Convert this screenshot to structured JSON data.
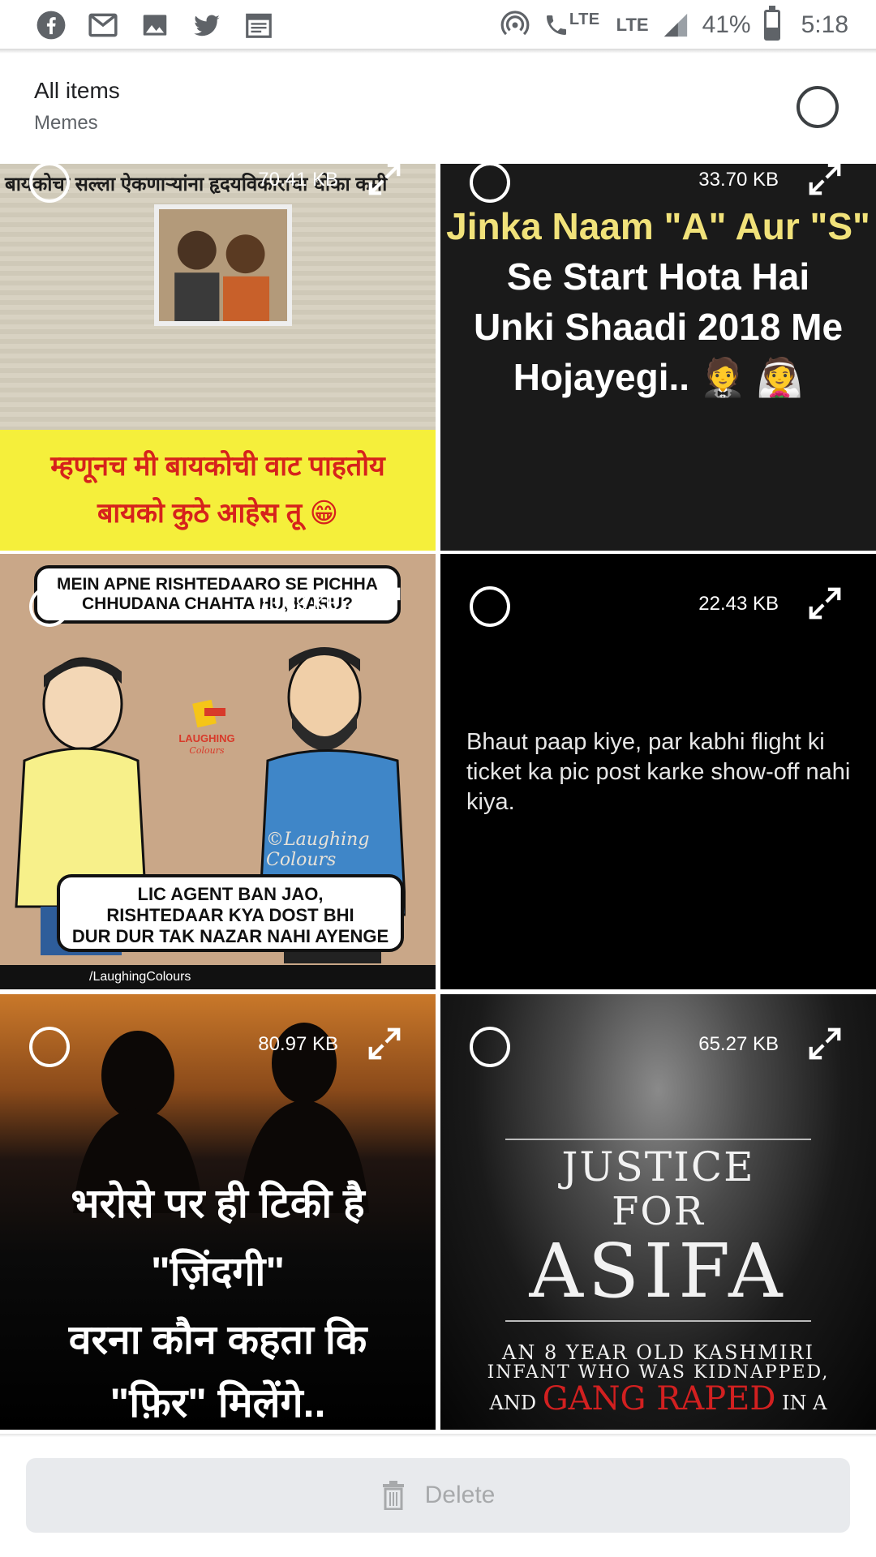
{
  "status_bar": {
    "icons_left": [
      "facebook-icon",
      "gmail-icon",
      "photos-icon",
      "twitter-icon",
      "calendar-icon"
    ],
    "lte_call_label": "LTE",
    "network_label": "LTE",
    "battery_percent": "41%",
    "battery_level": 0.41,
    "time": "5:18"
  },
  "header": {
    "title": "All items",
    "subtitle": "Memes"
  },
  "items": [
    {
      "size": "70.41 KB",
      "headline": "बायकोचा सल्ला ऐकणाऱ्यांना हृदयविकाराचा धोका कमी",
      "caption_line1": "म्हणूनच मी बायकोची वाट पाहतोय",
      "caption_line2": "बायको कुठे आहेस तू 😁"
    },
    {
      "size": "33.70 KB",
      "line1": "Jinka Naam \"A\" Aur \"S\"",
      "line2": "Se Start Hota Hai",
      "line3": "Unki Shaadi 2018 Me",
      "line4": "Hojayegi.. 🤵 👰"
    },
    {
      "size": "73.89 KB",
      "bubble_top_line1": "MEIN APNE RISHTEDAARO SE PICHHA",
      "bubble_top_line2": "CHHUDANA CHAHTA HU, KARU?",
      "bubble_bottom_line1": "LIC AGENT BAN JAO,",
      "bubble_bottom_line2": "RISHTEDAAR KYA DOST BHI",
      "bubble_bottom_line3": "DUR DUR TAK NAZAR NAHI AYENGE",
      "watermark": "©Laughing Colours",
      "footer": "/LaughingColours"
    },
    {
      "size": "22.43 KB",
      "text": "Bhaut paap kiye, par kabhi flight ki ticket ka pic post karke show-off nahi kiya."
    },
    {
      "size": "80.97 KB",
      "line1": "भरोसे पर ही टिकी है",
      "line2": "\"ज़िंदगी\"",
      "line3": "वरना कौन कहता कि",
      "line4": "\"फ़िर\" मिलेंगे.."
    },
    {
      "size": "65.27 KB",
      "justice": "JUSTICE",
      "for": "FOR",
      "name": "ASIFA",
      "sub1": "AN 8 YEAR OLD KASHMIRI",
      "sub2": "INFANT WHO WAS KIDNAPPED,",
      "sub3_a": "AND ",
      "sub3_red": "GANG RAPED",
      "sub3_b": " IN A"
    }
  ],
  "bottom": {
    "delete_label": "Delete"
  },
  "colors": {
    "status_icon": "#5f6368",
    "delete_bg": "#e8eaed",
    "delete_text": "#a7a9ab",
    "meme_red": "#d6221c",
    "meme_yellow": "#f5ef3b"
  }
}
